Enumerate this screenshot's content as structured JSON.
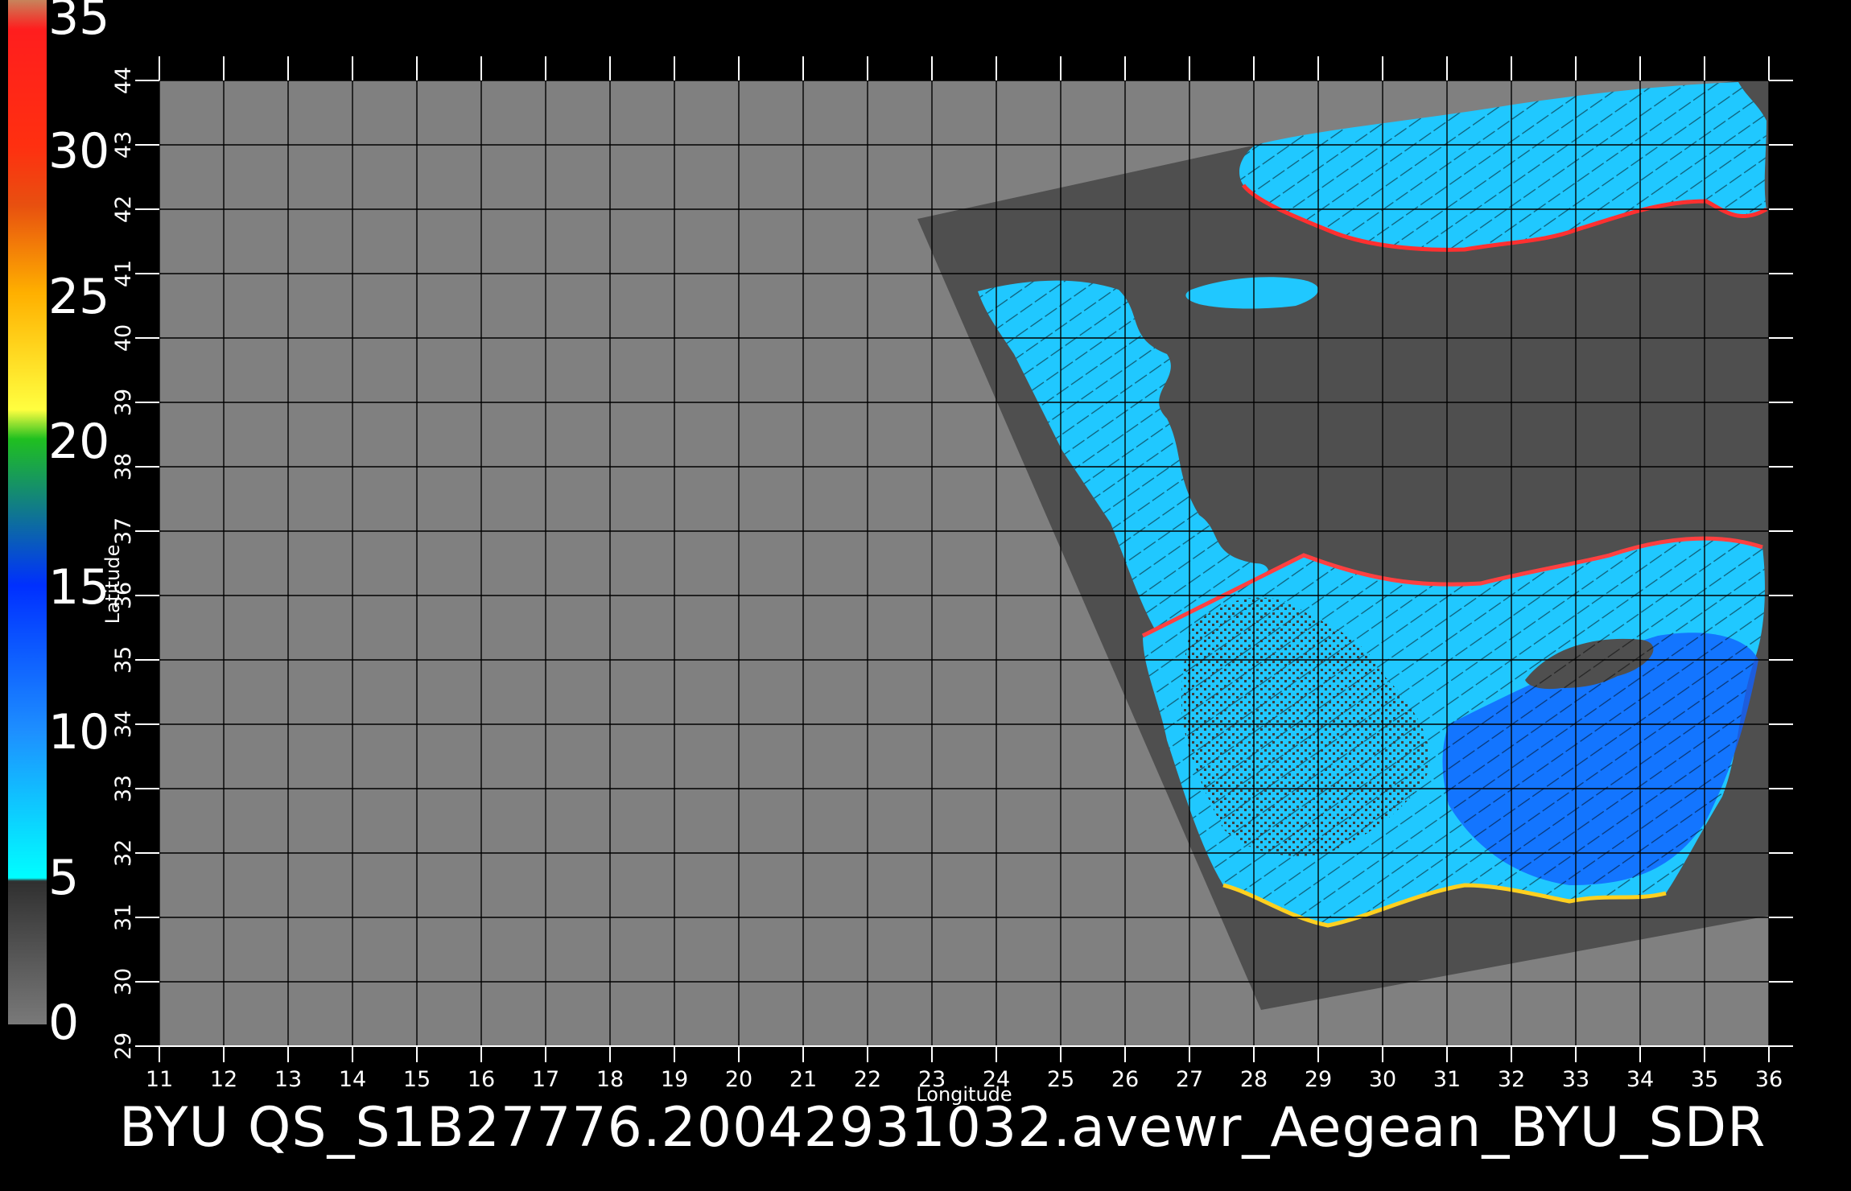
{
  "colorbar": {
    "labels": [
      "35",
      "30",
      "25",
      "20",
      "15",
      "10",
      "5",
      "0"
    ],
    "stops": [
      {
        "value": 35,
        "color": "#c8845c"
      },
      {
        "value": 34,
        "color": "#ff1e1e"
      },
      {
        "value": 30,
        "color": "#ff3010"
      },
      {
        "value": 28,
        "color": "#e85010"
      },
      {
        "value": 25,
        "color": "#ffb000"
      },
      {
        "value": 21,
        "color": "#ffff40"
      },
      {
        "value": 20,
        "color": "#20c020"
      },
      {
        "value": 15,
        "color": "#0030ff"
      },
      {
        "value": 10,
        "color": "#1e90ff"
      },
      {
        "value": 5,
        "color": "#00ffff"
      },
      {
        "value": 4.9,
        "color": "#303030"
      },
      {
        "value": 0,
        "color": "#7a7a7a"
      }
    ]
  },
  "map": {
    "xlabel": "Longitude",
    "ylabel": "Latitude",
    "lon_range": [
      11,
      36
    ],
    "lat_range": [
      29,
      44
    ],
    "lon_ticks": [
      "11",
      "12",
      "13",
      "14",
      "15",
      "16",
      "17",
      "18",
      "19",
      "20",
      "21",
      "22",
      "23",
      "24",
      "25",
      "26",
      "27",
      "28",
      "29",
      "30",
      "31",
      "32",
      "33",
      "34",
      "35",
      "36"
    ],
    "lat_ticks": [
      "29",
      "30",
      "31",
      "32",
      "33",
      "34",
      "35",
      "36",
      "37",
      "38",
      "39",
      "40",
      "41",
      "42",
      "43",
      "44"
    ],
    "colors": {
      "background": "#808080",
      "swath": "#4f4f4f",
      "grid": "#000000",
      "sea": "#20c8ff",
      "sea_deep": "#1060ff",
      "calm": "#404040"
    }
  },
  "footer": {
    "title": "BYU  QS_S1B27776.20042931032.avewr_Aegean_BYU_SDR"
  }
}
